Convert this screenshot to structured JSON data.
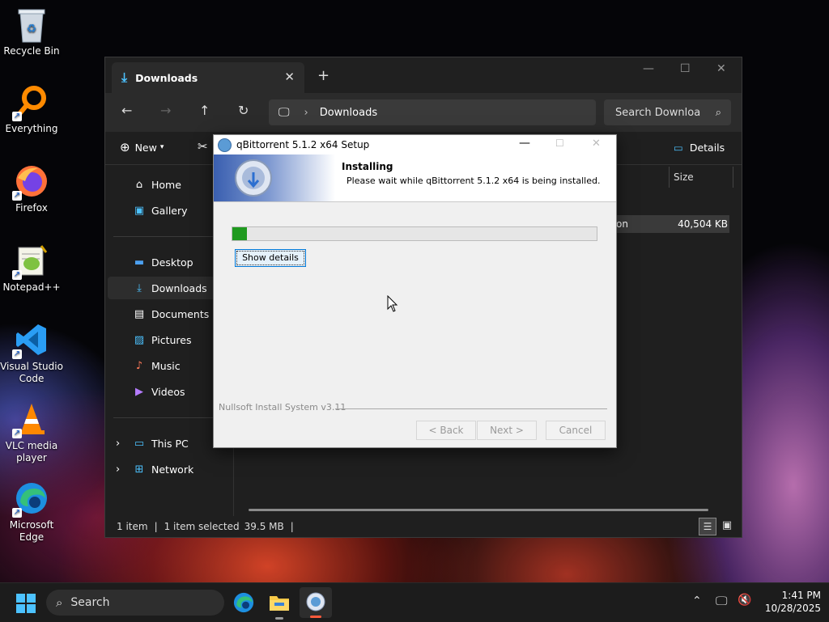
{
  "desktop": {
    "icons": [
      {
        "label": "Recycle Bin"
      },
      {
        "label": "Everything"
      },
      {
        "label": "Firefox"
      },
      {
        "label": "Notepad++"
      },
      {
        "label": "Visual Studio Code"
      },
      {
        "label": "VLC media player"
      },
      {
        "label": "Microsoft Edge"
      }
    ]
  },
  "explorer": {
    "tab_label": "Downloads",
    "address_segment": "Downloads",
    "search_placeholder": "Search Downloa",
    "toolbar": {
      "new_label": "New",
      "details_label": "Details"
    },
    "column_size": "Size",
    "file_row": {
      "name_fragment": "on",
      "size": "40,504 KB"
    },
    "sidebar": {
      "items": [
        {
          "label": "Home"
        },
        {
          "label": "Gallery"
        },
        {
          "label": "Desktop"
        },
        {
          "label": "Downloads"
        },
        {
          "label": "Documents"
        },
        {
          "label": "Pictures"
        },
        {
          "label": "Music"
        },
        {
          "label": "Videos"
        },
        {
          "label": "This PC"
        },
        {
          "label": "Network"
        }
      ]
    },
    "status": {
      "count": "1 item",
      "selected": "1 item selected",
      "size": "39.5 MB"
    }
  },
  "setup": {
    "title": "qBittorrent 5.1.2 x64 Setup",
    "heading": "Installing",
    "subheading": "Please wait while qBittorrent 5.1.2 x64 is being installed.",
    "progress": 0.04,
    "show_details": "Show details",
    "footer": "Nullsoft Install System v3.11",
    "back": "< Back",
    "next": "Next >",
    "cancel": "Cancel"
  },
  "taskbar": {
    "search_label": "Search",
    "time": "1:41 PM",
    "date": "10/28/2025"
  },
  "colors": {
    "accent": "#4cc2ff",
    "progress": "#1f9a1f"
  }
}
